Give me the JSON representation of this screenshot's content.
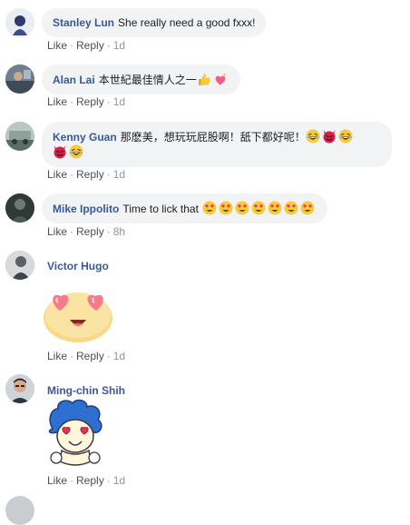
{
  "comments": [
    {
      "name": "Stanley Lun",
      "text": "She really need a good fxxx!",
      "like": "Like",
      "reply": "Reply",
      "time": "1d"
    },
    {
      "name": "Alan Lai",
      "text": "本世紀最佳情人之一",
      "emojis": [
        "thumbs-up-icon",
        "sparkling-heart-icon"
      ],
      "like": "Like",
      "reply": "Reply",
      "time": "1d"
    },
    {
      "name": "Kenny Guan",
      "text": "那麽美，想玩玩屁股啊！舐下都好呢！",
      "emojis": [
        "laughing-face-icon",
        "devil-face-icon",
        "laughing-face-icon",
        "devil-face-icon",
        "laughing-face-icon"
      ],
      "like": "Like",
      "reply": "Reply",
      "time": "1d"
    },
    {
      "name": "Mike Ippolito",
      "text": "Time to lick that",
      "emojis": [
        "heart-eyes-face-icon",
        "heart-eyes-face-icon",
        "heart-eyes-face-icon",
        "heart-eyes-face-icon",
        "heart-eyes-face-icon",
        "heart-eyes-face-icon",
        "heart-eyes-face-icon"
      ],
      "like": "Like",
      "reply": "Reply",
      "time": "8h"
    },
    {
      "name": "Victor Hugo",
      "sticker": "heart-eyes-face-sticker",
      "like": "Like",
      "reply": "Reply",
      "time": "1d"
    },
    {
      "name": "Ming-chin Shih",
      "sticker": "heart-eyes-cartoon-sticker",
      "like": "Like",
      "reply": "Reply",
      "time": "1d"
    }
  ],
  "colors": {
    "name_link": "#385898",
    "bubble_bg": "#f2f3f5",
    "meta_gray": "#90949c"
  }
}
